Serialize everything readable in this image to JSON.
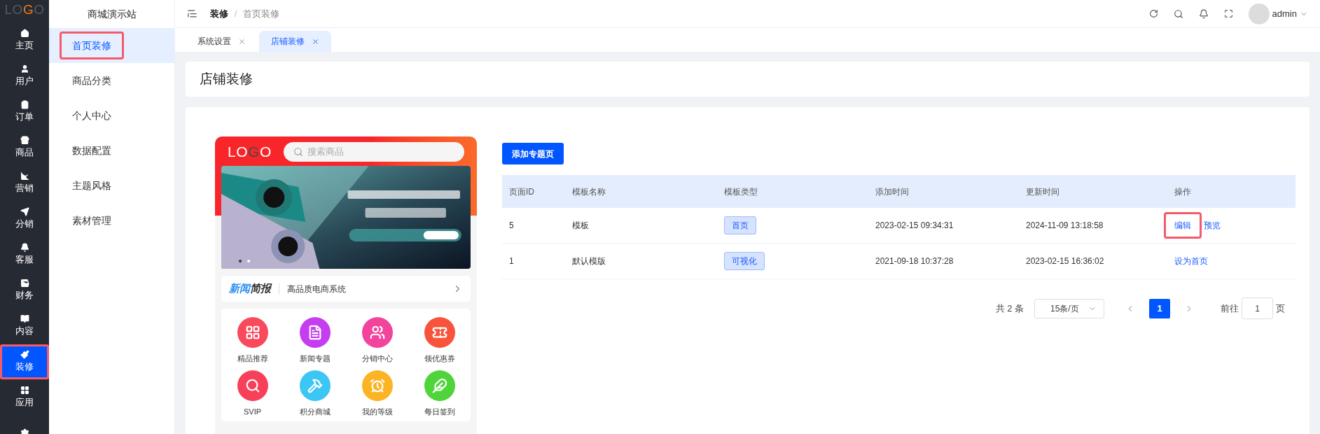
{
  "rail": {
    "logo": [
      "LO",
      "G",
      "O"
    ],
    "items": [
      {
        "label": "主页",
        "selected": false,
        "highlighted": false
      },
      {
        "label": "用户",
        "selected": false,
        "highlighted": false
      },
      {
        "label": "订单",
        "selected": false,
        "highlighted": false
      },
      {
        "label": "商品",
        "selected": false,
        "highlighted": false
      },
      {
        "label": "营销",
        "selected": false,
        "highlighted": false
      },
      {
        "label": "分销",
        "selected": false,
        "highlighted": false
      },
      {
        "label": "客服",
        "selected": false,
        "highlighted": false
      },
      {
        "label": "财务",
        "selected": false,
        "highlighted": false
      },
      {
        "label": "内容",
        "selected": false,
        "highlighted": false
      },
      {
        "label": "装修",
        "selected": true,
        "highlighted": true
      },
      {
        "label": "应用",
        "selected": false,
        "highlighted": false
      },
      {
        "selected": false,
        "highlighted": false
      }
    ]
  },
  "sidebar": {
    "title": "商城演示站",
    "items": [
      {
        "label": "首页装修",
        "selected": true,
        "highlighted": true
      },
      {
        "label": "商品分类",
        "selected": false,
        "highlighted": false
      },
      {
        "label": "个人中心",
        "selected": false,
        "highlighted": false
      },
      {
        "label": "数据配置",
        "selected": false,
        "highlighted": false
      },
      {
        "label": "主题风格",
        "selected": false,
        "highlighted": false
      },
      {
        "label": "素材管理",
        "selected": false,
        "highlighted": false
      }
    ]
  },
  "header": {
    "breadcrumb": [
      "装修",
      "首页装修"
    ],
    "separator": "/",
    "user": "admin"
  },
  "tabs": [
    {
      "label": "系统设置",
      "selected": false
    },
    {
      "label": "店铺装修",
      "selected": true
    }
  ],
  "page_title": "店铺装修",
  "preview": {
    "logo": [
      "L",
      "O",
      "G",
      "O"
    ],
    "search_placeholder": "搜索商品",
    "news": {
      "title": [
        "新闻",
        "简报"
      ],
      "text": "高品质电商系统"
    },
    "icons": [
      {
        "label": "精品推荐",
        "color": "#f84a5c"
      },
      {
        "label": "新闻专题",
        "color": "#c43df0"
      },
      {
        "label": "分销中心",
        "color": "#f2449c"
      },
      {
        "label": "领优惠券",
        "color": "#f8543c"
      },
      {
        "label": "SVIP",
        "color": "#f8405a"
      },
      {
        "label": "积分商城",
        "color": "#3cc6f4"
      },
      {
        "label": "我的等级",
        "color": "#fbb424"
      },
      {
        "label": "每日签到",
        "color": "#4fd43a"
      }
    ]
  },
  "add_button": "添加专题页",
  "table": {
    "columns": [
      "页面ID",
      "模板名称",
      "模板类型",
      "添加时间",
      "更新时间",
      "操作"
    ],
    "rows": [
      {
        "id": "5",
        "name": "模板",
        "type": "首页",
        "added": "2023-02-15 09:34:31",
        "updated": "2024-11-09 13:18:58",
        "actions": [
          {
            "label": "编辑",
            "highlighted": true
          },
          {
            "label": "预览",
            "highlighted": false
          }
        ]
      },
      {
        "id": "1",
        "name": "默认模版",
        "type": "可视化",
        "added": "2021-09-18 10:37:28",
        "updated": "2023-02-15 16:36:02",
        "actions": [
          {
            "label": "设为首页",
            "highlighted": false
          }
        ]
      }
    ]
  },
  "pagination": {
    "total": "共 2 条",
    "page_size": "15条/页",
    "pages": [
      {
        "label": "1",
        "selected": true
      }
    ],
    "goto_label": "前往",
    "goto_value": "1",
    "goto_suffix": "页"
  }
}
